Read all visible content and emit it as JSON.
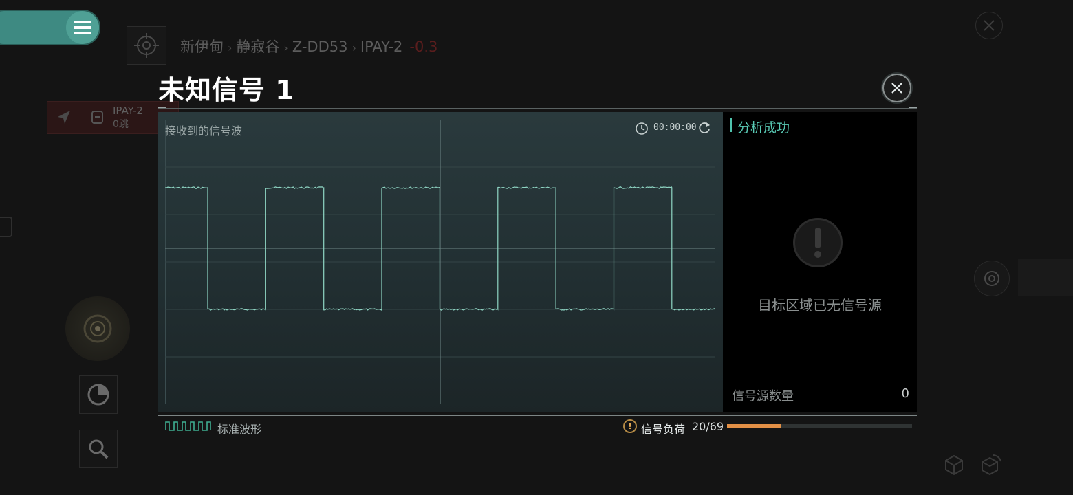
{
  "hud": {
    "breadcrumb": {
      "region": "新伊甸",
      "constellation": "静寂谷",
      "system": "Z-DD53",
      "location": "IPAY-2",
      "security": "-0.3"
    },
    "route": {
      "destination": "IPAY-2",
      "jumps": "0跳"
    },
    "icons": {
      "menu": "menu-icon",
      "target": "crosshair-icon",
      "navigate": "navigation-arrow-icon",
      "radar": "radar-icon",
      "chart": "pie-chart-icon",
      "search": "search-icon",
      "cube": "cube-icon",
      "close": "close-icon"
    }
  },
  "modal": {
    "title": "未知信号 1",
    "scope": {
      "label": "接收到的信号波",
      "timer": "00:00:00",
      "waveform": {
        "type": "square",
        "high": 1,
        "low": 0,
        "period_count": 5
      }
    },
    "analysis": {
      "status": "分析成功",
      "message": "目标区域已无信号源",
      "count_label": "信号源数量",
      "count_value": "0"
    },
    "footer": {
      "waveform_label": "标准波形",
      "load_label": "信号负荷",
      "load_value": "20/69",
      "load_current": 20,
      "load_max": 69
    },
    "colors": {
      "accent": "#58c8b3",
      "warning": "#e39046",
      "security_status": "#8b2a2a"
    }
  }
}
